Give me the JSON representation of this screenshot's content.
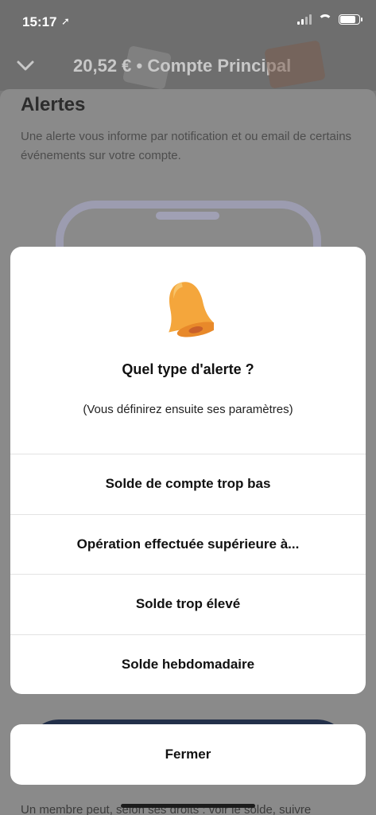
{
  "status_bar": {
    "time": "15:17",
    "location_glyph": "➚"
  },
  "header": {
    "title": "20,52 € • Compte Principal"
  },
  "page": {
    "title": "Alertes",
    "description": "Une alerte vous informe par notification et ou email de certains événements sur votre compte.",
    "bottom_text": "Un membre peut, selon ses droits : voir le solde, suivre"
  },
  "sheet": {
    "icon": "bell-icon",
    "title": "Quel type d'alerte ?",
    "subtitle": "(Vous définirez ensuite ses paramètres)",
    "options": [
      "Solde de compte trop bas",
      "Opération effectuée supérieure à...",
      "Solde trop élevé",
      "Solde hebdomadaire"
    ]
  },
  "close_label": "Fermer",
  "colors": {
    "bell": "#F4A63C",
    "overlay": "#7a7a7a"
  }
}
